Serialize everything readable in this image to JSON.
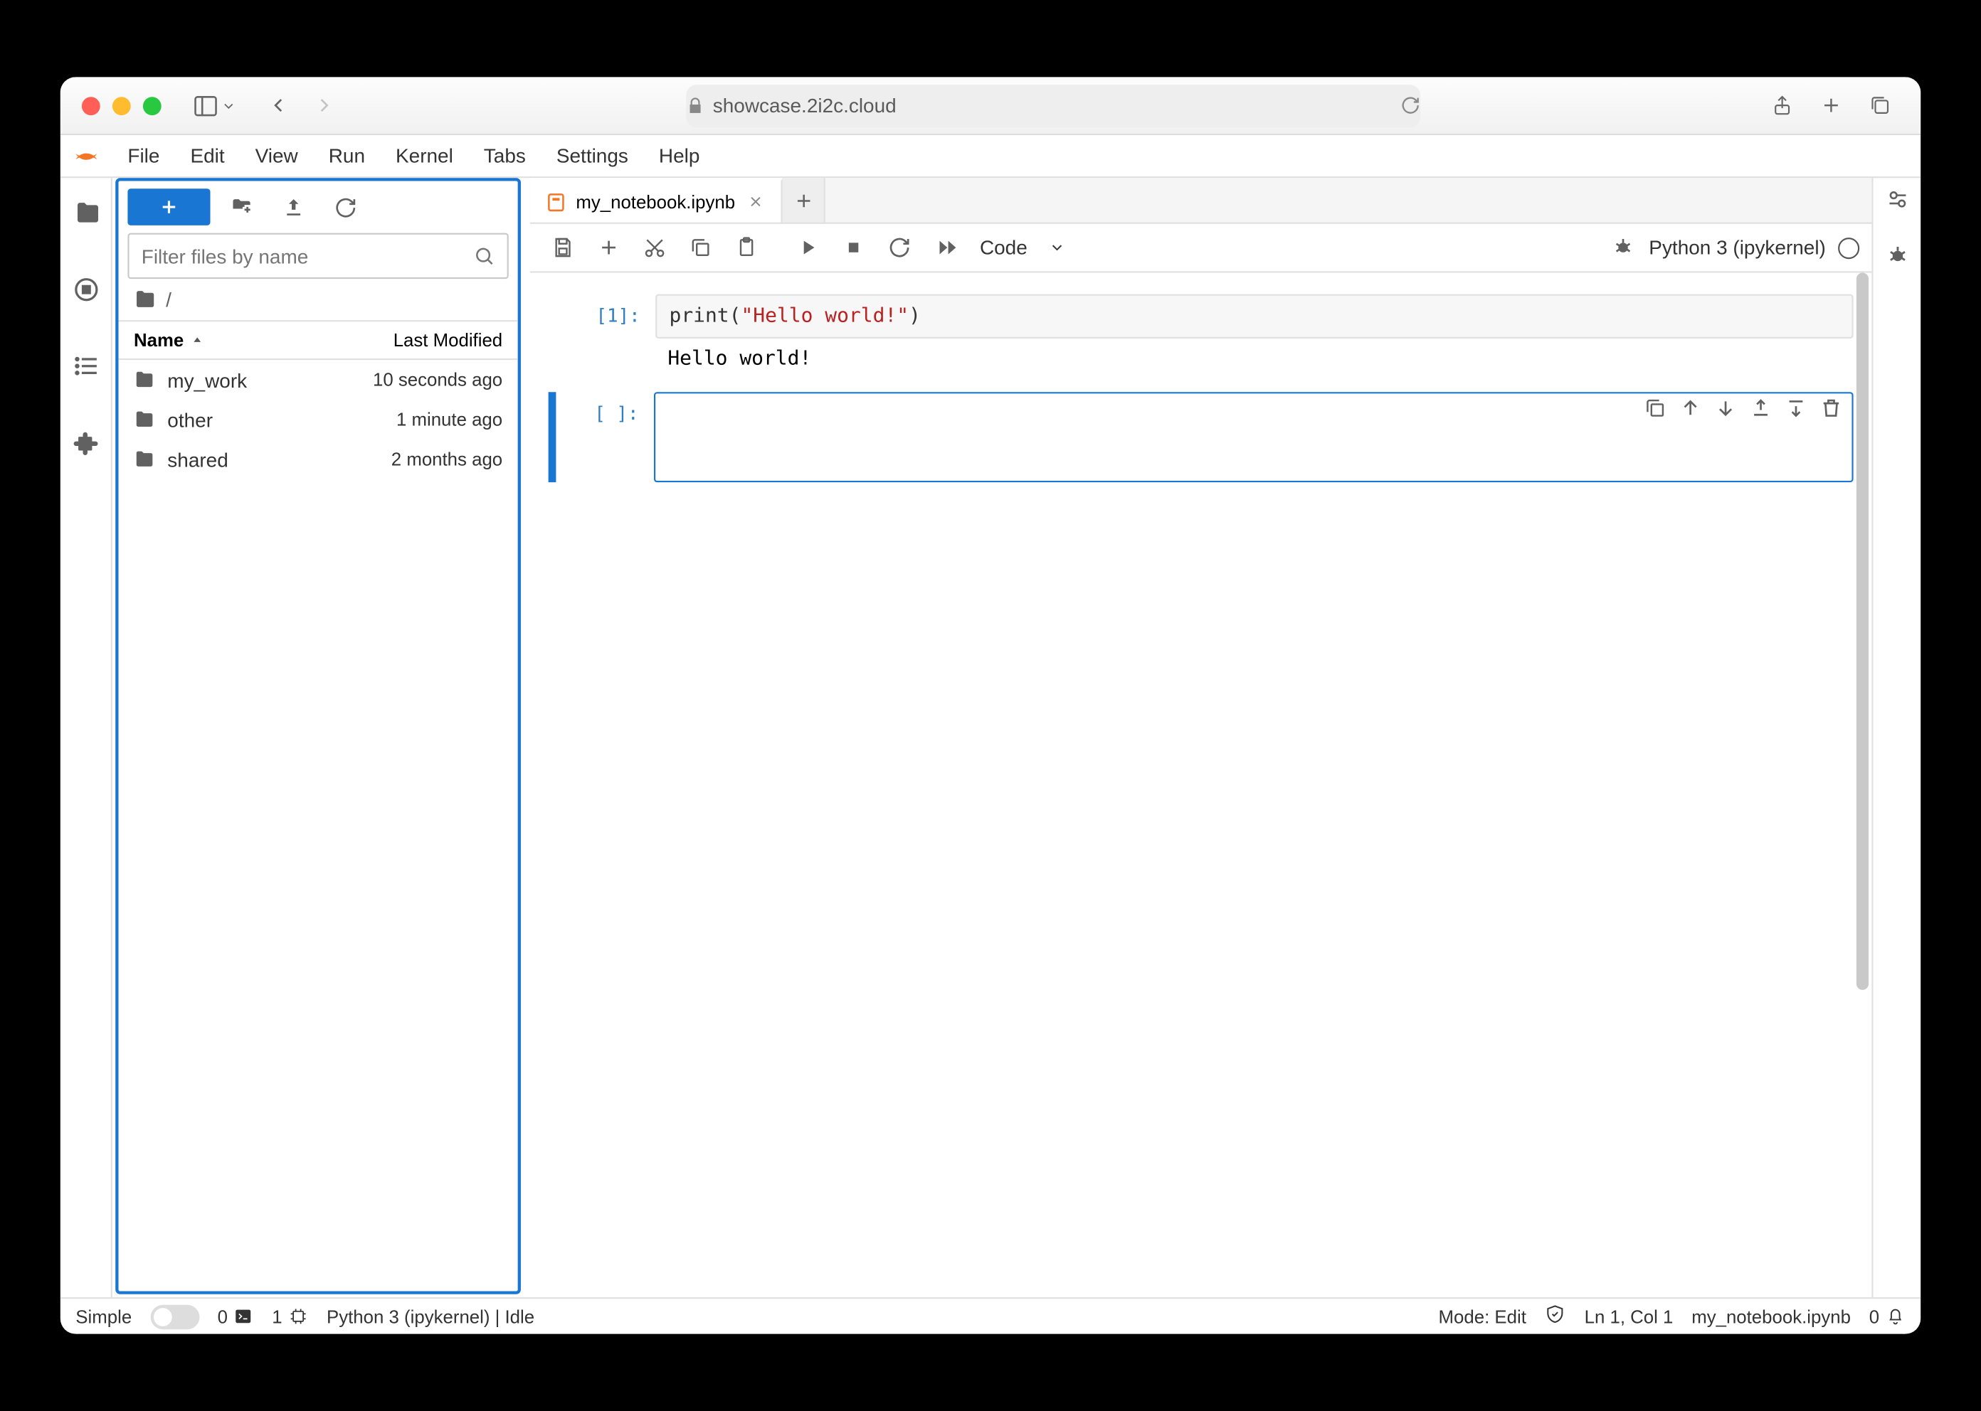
{
  "browser": {
    "url": "showcase.2i2c.cloud"
  },
  "menubar": [
    "File",
    "Edit",
    "View",
    "Run",
    "Kernel",
    "Tabs",
    "Settings",
    "Help"
  ],
  "filebrowser": {
    "filter_placeholder": "Filter files by name",
    "breadcrumb": "/",
    "name_header": "Name",
    "modified_header": "Last Modified",
    "items": [
      {
        "name": "my_work",
        "modified": "10 seconds ago"
      },
      {
        "name": "other",
        "modified": "1 minute ago"
      },
      {
        "name": "shared",
        "modified": "2 months ago"
      }
    ]
  },
  "tab": {
    "title": "my_notebook.ipynb"
  },
  "toolbar": {
    "celltype": "Code",
    "kernel": "Python 3 (ipykernel)"
  },
  "cells": [
    {
      "prompt": "[1]:",
      "code_pre": "print(",
      "code_str": "\"Hello world!\"",
      "code_post": ")",
      "output": "Hello world!"
    },
    {
      "prompt": "[ ]:"
    }
  ],
  "status": {
    "simple": "Simple",
    "terminals": "0",
    "kernels": "1",
    "kernel_status": "Python 3 (ipykernel) | Idle",
    "mode": "Mode: Edit",
    "ln": "Ln 1, Col 1",
    "filename": "my_notebook.ipynb",
    "notifications": "0"
  }
}
